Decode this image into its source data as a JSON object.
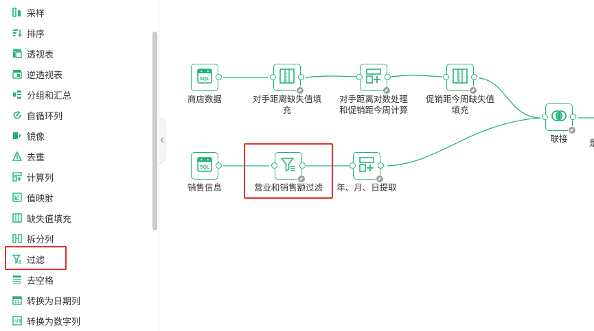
{
  "sidebar": {
    "items": [
      {
        "label": "采样",
        "icon": "sample-icon"
      },
      {
        "label": "排序",
        "icon": "sort-icon"
      },
      {
        "label": "透视表",
        "icon": "pivot-table-icon"
      },
      {
        "label": "逆透视表",
        "icon": "unpivot-table-icon"
      },
      {
        "label": "分组和汇总",
        "icon": "group-summary-icon"
      },
      {
        "label": "自循环列",
        "icon": "self-loop-icon"
      },
      {
        "label": "镜像",
        "icon": "mirror-icon"
      },
      {
        "label": "去重",
        "icon": "dedupe-icon"
      },
      {
        "label": "计算列",
        "icon": "calculated-column-icon"
      },
      {
        "label": "值映射",
        "icon": "value-mapping-icon"
      },
      {
        "label": "缺失值填充",
        "icon": "missing-value-fill-icon"
      },
      {
        "label": "拆分列",
        "icon": "split-column-icon"
      },
      {
        "label": "过滤",
        "icon": "filter-icon"
      },
      {
        "label": "去空格",
        "icon": "trim-spaces-icon"
      },
      {
        "label": "转换为日期列",
        "icon": "convert-date-icon"
      },
      {
        "label": "转换为数字列",
        "icon": "convert-number-icon"
      }
    ]
  },
  "canvas": {
    "nodes": {
      "shop_data": {
        "label": "商店数据",
        "icon": "sql-icon"
      },
      "fill1": {
        "label1": "对手距离缺失值填",
        "label2": "充",
        "icon": "missing-value-fill-icon"
      },
      "calc1": {
        "label1": "对手距离对数处理",
        "label2": "和促销距今周计算",
        "icon": "calculated-column-icon"
      },
      "fill2": {
        "label1": "促销距今周缺失值",
        "label2": "填充",
        "icon": "missing-value-fill-icon"
      },
      "join": {
        "label": "联接",
        "icon": "join-icon"
      },
      "next_partial": {
        "label": "是"
      },
      "sales_info": {
        "label": "销售信息",
        "icon": "sql-icon"
      },
      "filter": {
        "label": "营业和销售额过滤",
        "icon": "filter-icon"
      },
      "extract": {
        "label": "年、月、日提取",
        "icon": "calculated-column-icon"
      }
    }
  },
  "colors": {
    "accent": "#22b573",
    "highlight": "#e0322b",
    "text": "#333333",
    "badge": "#9aa0a6"
  }
}
